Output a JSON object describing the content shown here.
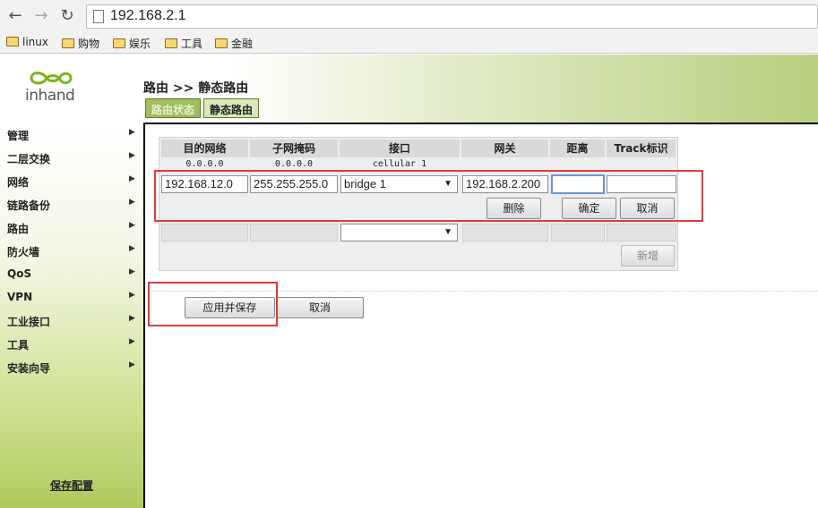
{
  "browser": {
    "url": "192.168.2.1",
    "bookmarks": [
      "linux",
      "购物",
      "娱乐",
      "工具",
      "金融"
    ]
  },
  "header": {
    "logo_text": "inhand",
    "breadcrumb": "路由 >> 静态路由",
    "tabs": [
      "路由状态",
      "静态路由"
    ]
  },
  "sidebar": {
    "items": [
      "管理",
      "二层交换",
      "网络",
      "链路备份",
      "路由",
      "防火墙",
      "QoS",
      "VPN",
      "工业接口",
      "工具",
      "安装向导"
    ],
    "save_config": "保存配置"
  },
  "table": {
    "headers": [
      "目的网络",
      "子网掩码",
      "接口",
      "网关",
      "距离",
      "Track标识"
    ],
    "existing_row": [
      "0.0.0.0",
      "0.0.0.0",
      "cellular 1"
    ],
    "edit_row": {
      "dest": "192.168.12.0",
      "mask": "255.255.255.0",
      "interface": "bridge 1",
      "gateway": "192.168.2.200",
      "distance": "",
      "track": ""
    },
    "buttons": {
      "delete": "删除",
      "confirm": "确定",
      "cancel": "取消",
      "add": "新增"
    }
  },
  "form": {
    "apply_save": "应用并保存",
    "cancel": "取消"
  },
  "colors": {
    "highlight": "#e03a3a",
    "header_green": "#b7cf7f"
  }
}
